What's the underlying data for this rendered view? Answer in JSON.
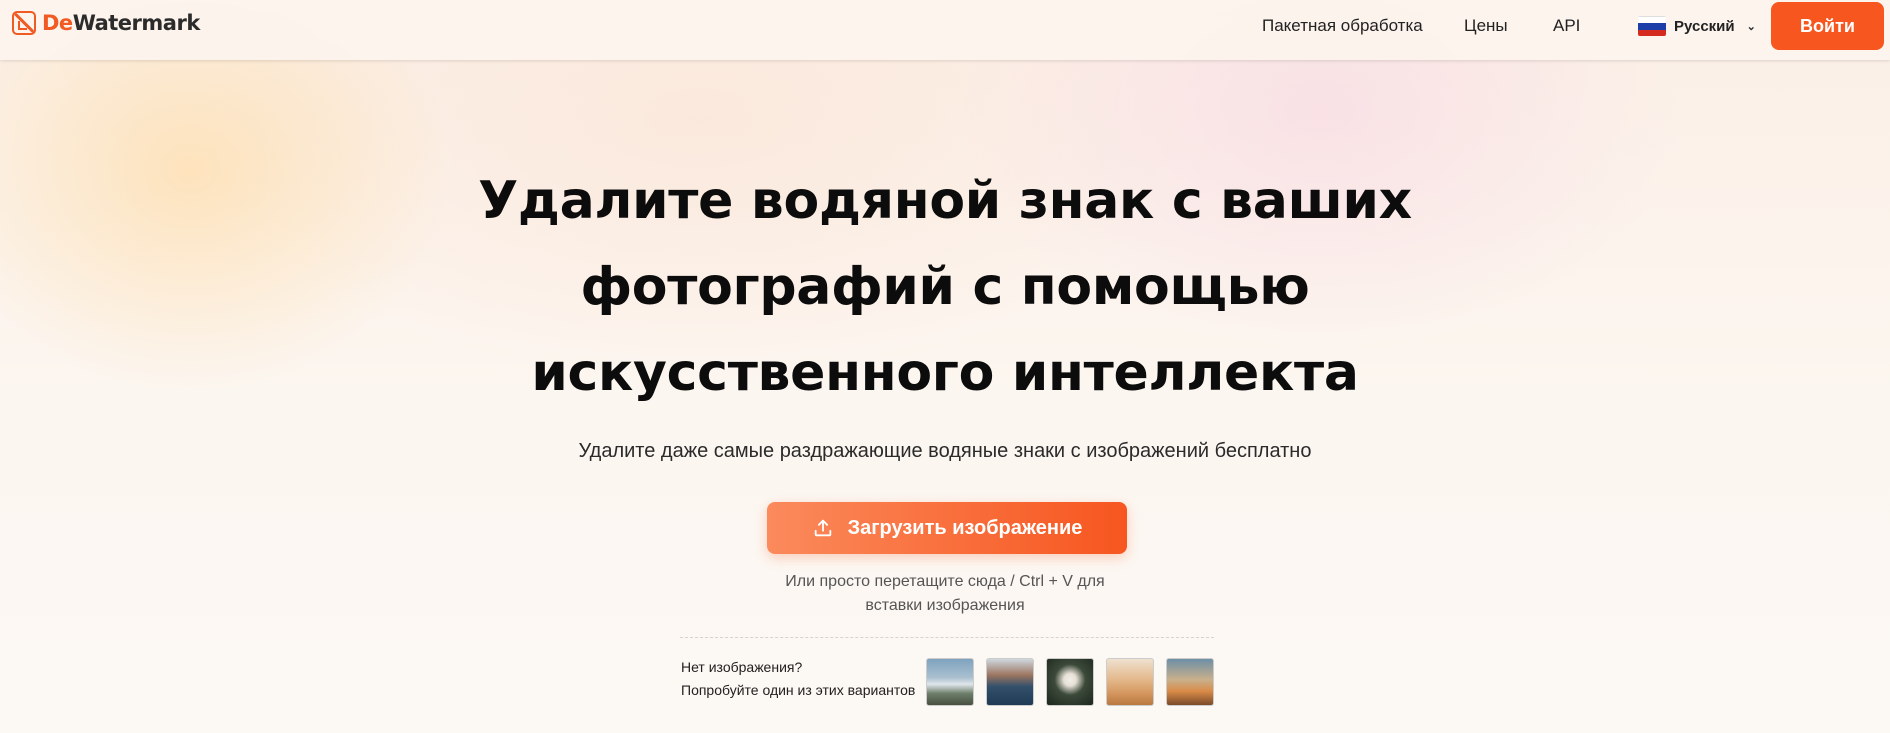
{
  "brand": {
    "prefix": "De",
    "name": "Watermark",
    "accent": "#f7561f"
  },
  "nav": {
    "batch": "Пакетная обработка",
    "prices": "Цены",
    "api": "API",
    "language": "Русский",
    "language_flag": "russia-flag-icon",
    "login": "Войти"
  },
  "hero": {
    "headline": "Удалите водяной знак с ваших фотографий с помощью искусственного интеллекта",
    "subtitle": "Удалите даже самые раздражающие водяные знаки с изображений бесплатно",
    "upload_label": "Загрузить изображение",
    "upload_icon": "upload-icon",
    "hint_line1": "Или просто перетащите сюда / Ctrl + V для",
    "hint_line2": "вставки изображения"
  },
  "samples": {
    "line1": "Нет изображения?",
    "line2": "Попробуйте один из этих вариантов",
    "thumbnails": [
      "house-photo",
      "coast-photo",
      "bride-photo",
      "desert-photo",
      "sunset-photo"
    ]
  }
}
